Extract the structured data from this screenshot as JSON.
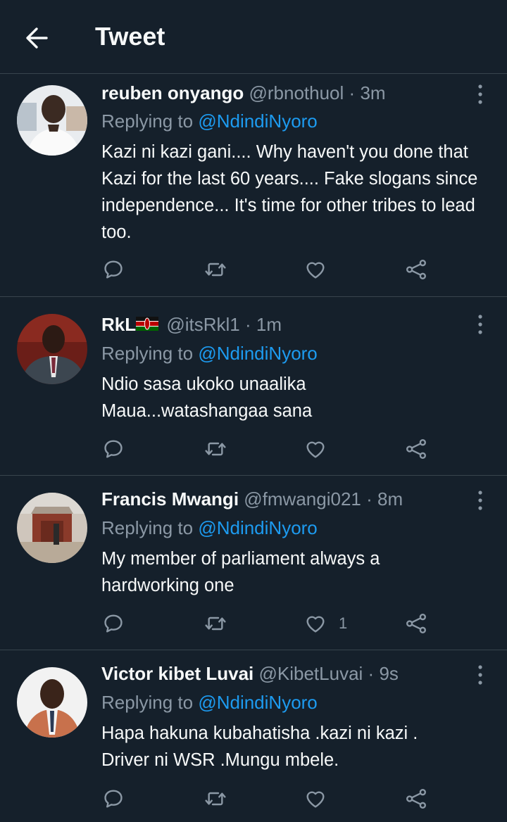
{
  "header": {
    "title": "Tweet"
  },
  "tweets": [
    {
      "name": "reuben onyango",
      "handle": "@rbnothuol",
      "time": "3m",
      "replying_prefix": "Replying to ",
      "replying_to": "@NdindiNyoro",
      "text": "Kazi ni kazi gani.... Why haven't you done that Kazi for the last 60 years.... Fake slogans since independence... It's time for other tribes to lead too.",
      "like_count": ""
    },
    {
      "name": "RkL",
      "handle": "@itsRkl1",
      "time": "1m",
      "replying_prefix": "Replying to ",
      "replying_to": "@NdindiNyoro",
      "text": "Ndio sasa ukoko unaalika Maua...watashangaa sana",
      "like_count": ""
    },
    {
      "name": "Francis Mwangi",
      "handle": "@fmwangi021",
      "time": "8m",
      "replying_prefix": "Replying to ",
      "replying_to": "@NdindiNyoro",
      "text": "My member of parliament always a hardworking one",
      "like_count": "1"
    },
    {
      "name": "Victor kibet Luvai",
      "handle": "@KibetLuvai",
      "time": "9s",
      "replying_prefix": "Replying to ",
      "replying_to": "@NdindiNyoro",
      "text": "Hapa hakuna kubahatisha .kazi ni kazi . Driver ni WSR .Mungu mbele.",
      "like_count": ""
    }
  ],
  "colors": {
    "background": "#15202b",
    "divider": "#38444d",
    "secondary_text": "#8b98a5",
    "accent": "#1d9bf0"
  },
  "icons": {
    "back": "arrow-left-icon",
    "more": "more-vertical-icon",
    "reply": "comment-icon",
    "retweet": "retweet-icon",
    "like": "heart-icon",
    "share": "share-icon"
  }
}
